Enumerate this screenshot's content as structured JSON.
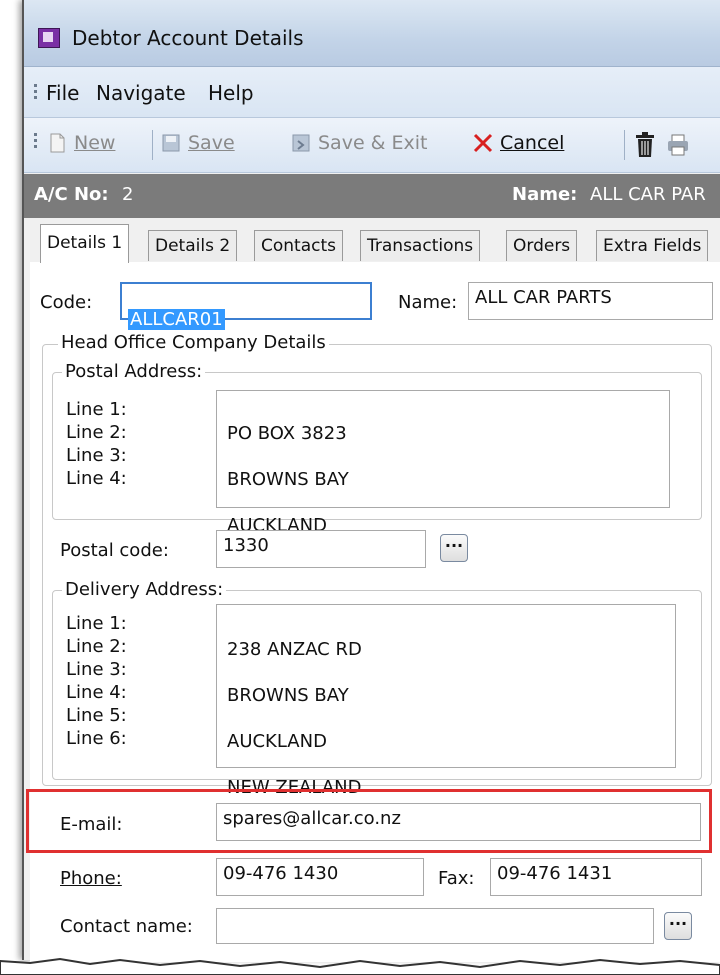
{
  "window": {
    "title": "Debtor Account Details"
  },
  "menu": [
    "File",
    "Navigate",
    "Help"
  ],
  "toolbar": {
    "new_label": "New",
    "save_label": "Save",
    "save_exit_label": "Save & Exit",
    "cancel_label": "Cancel"
  },
  "account": {
    "ac_label": "A/C No:",
    "ac_value": "2",
    "name_label": "Name:",
    "name_value": "ALL CAR PAR"
  },
  "tabs": [
    "Details 1",
    "Details 2",
    "Contacts",
    "Transactions",
    "Orders",
    "Extra Fields"
  ],
  "form": {
    "code_label": "Code:",
    "code_value": "ALLCAR01",
    "name_label": "Name:",
    "name_value": "ALL CAR PARTS",
    "head_office_title": "Head Office Company Details",
    "postal": {
      "title": "Postal Address:",
      "labels": [
        "Line 1:",
        "Line 2:",
        "Line 3:",
        "Line 4:"
      ],
      "lines": [
        "PO BOX 3823",
        "BROWNS BAY",
        "AUCKLAND"
      ]
    },
    "postal_code_label": "Postal code:",
    "postal_code_value": "1330",
    "delivery": {
      "title": "Delivery Address:",
      "labels": [
        "Line 1:",
        "Line 2:",
        "Line 3:",
        "Line 4:",
        "Line 5:",
        "Line 6:"
      ],
      "lines": [
        "238 ANZAC RD",
        "BROWNS BAY",
        "AUCKLAND",
        "NEW ZEALAND"
      ]
    },
    "email_label": "E-mail:",
    "email_value": "spares@allcar.co.nz",
    "phone_label": "Phone:",
    "phone_value": "09-476 1430",
    "fax_label": "Fax:",
    "fax_value": "09-476 1431",
    "contact_label": "Contact name:",
    "contact_value": "",
    "lookup_button": "..."
  },
  "colors": {
    "highlight": "#e03030",
    "acbar": "#7b7b7b",
    "selection": "#3399ff"
  }
}
